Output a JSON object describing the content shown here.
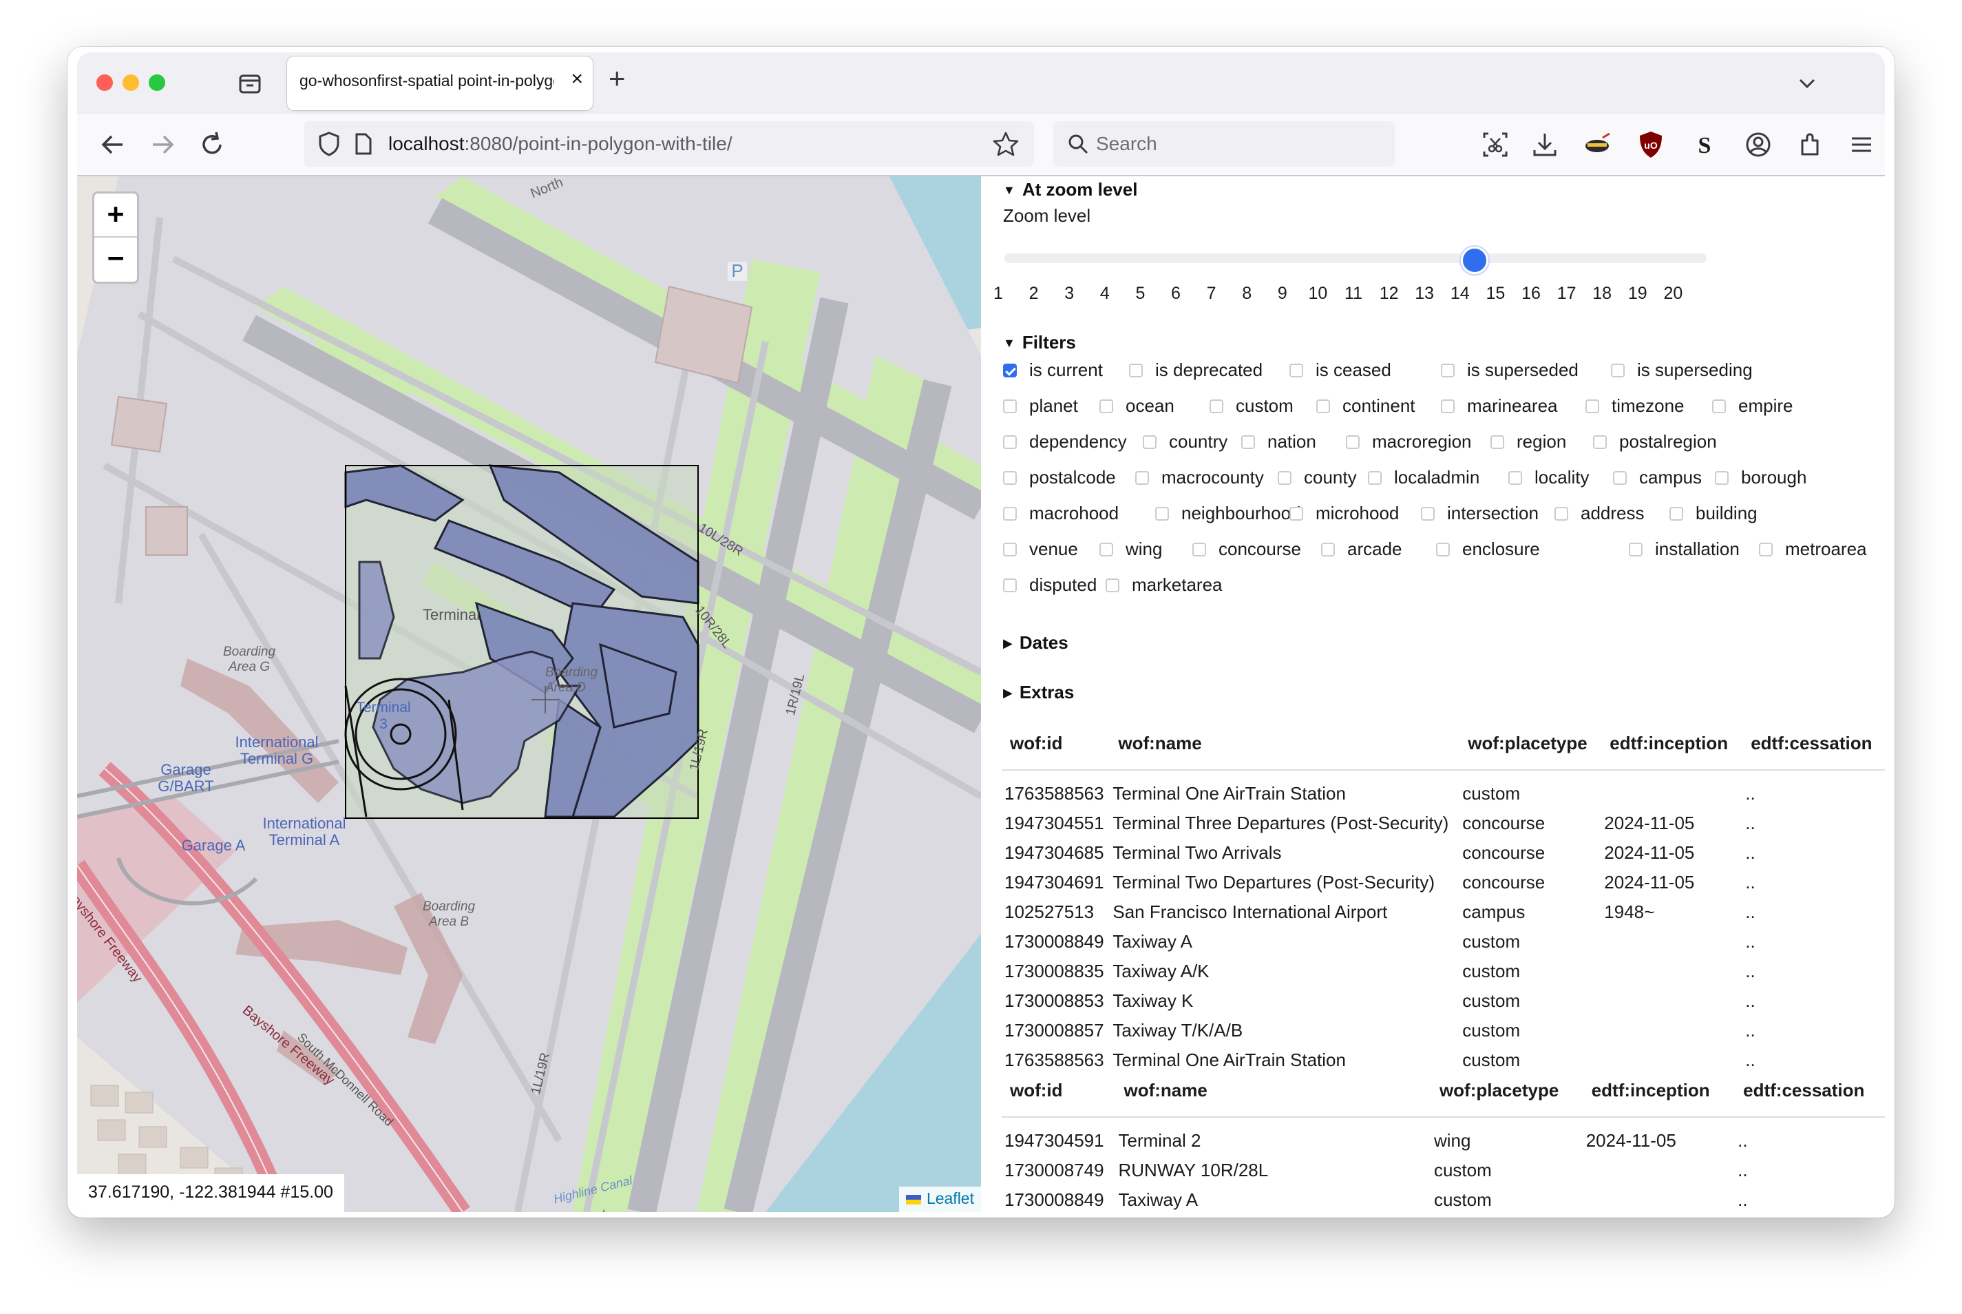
{
  "browser": {
    "tab_title": "go-whosonfirst-spatial point-in-polygon-with-tile",
    "url_host": "localhost",
    "url_rest": ":8080/point-in-polygon-with-tile/",
    "search_placeholder": "Search",
    "traffic_lights": {
      "close": "#fe5f57",
      "minimize": "#febc2e",
      "zoom": "#28c840"
    }
  },
  "map": {
    "zoom_in_label": "+",
    "zoom_out_label": "−",
    "coordinates": "37.617190, -122.381944 #15.00",
    "attribution": "Leaflet",
    "labels": {
      "terminal": "Terminal",
      "boarding_g": "Boarding Area G",
      "boarding_d": "Boarding Area D",
      "boarding_b": "Boarding Area B",
      "intl_terminal_g": "International Terminal G",
      "intl_terminal_a": "International Terminal A",
      "garage_g": "Garage G/BART",
      "garage_a": "Garage A",
      "terminal_3": "Terminal 3",
      "bayshore_1": "Bayshore Freeway",
      "bayshore_2": "Bayshore Freeway",
      "south_mcdonnell": "South McDonnell Road",
      "highline": "Highline Canal",
      "runway_10l": "10L/28R",
      "runway_10r": "10R/28L",
      "runway_1l": "1L/19R",
      "runway_1r": "1R/19L",
      "north": "North"
    }
  },
  "panel": {
    "zoom_section": "At zoom level",
    "zoom_label": "Zoom level",
    "zoom_value": 15,
    "zoom_ticks": [
      "1",
      "2",
      "3",
      "4",
      "5",
      "6",
      "7",
      "8",
      "9",
      "10",
      "11",
      "12",
      "13",
      "14",
      "15",
      "16",
      "17",
      "18",
      "19",
      "20"
    ],
    "filters_section": "Filters",
    "filter_rows": [
      [
        {
          "label": "is current",
          "checked": true
        },
        {
          "label": "is deprecated"
        },
        {
          "label": "is ceased"
        },
        {
          "label": "is superseded"
        },
        {
          "label": "is superseding"
        }
      ],
      [
        {
          "label": "planet"
        },
        {
          "label": "ocean"
        },
        {
          "label": "custom"
        },
        {
          "label": "continent"
        },
        {
          "label": "marinearea"
        },
        {
          "label": "timezone"
        },
        {
          "label": "empire"
        }
      ],
      [
        {
          "label": "dependency"
        },
        {
          "label": "country"
        },
        {
          "label": "nation"
        },
        {
          "label": "macroregion"
        },
        {
          "label": "region"
        },
        {
          "label": "postalregion"
        }
      ],
      [
        {
          "label": "postalcode"
        },
        {
          "label": "macrocounty"
        },
        {
          "label": "county"
        },
        {
          "label": "localadmin"
        },
        {
          "label": "locality"
        },
        {
          "label": "campus"
        },
        {
          "label": "borough"
        }
      ],
      [
        {
          "label": "macrohood"
        },
        {
          "label": "neighbourhood"
        },
        {
          "label": "microhood"
        },
        {
          "label": "intersection"
        },
        {
          "label": "address"
        },
        {
          "label": "building"
        }
      ],
      [
        {
          "label": "venue"
        },
        {
          "label": "wing"
        },
        {
          "label": "concourse"
        },
        {
          "label": "arcade"
        },
        {
          "label": "enclosure"
        },
        {
          "label": "installation"
        },
        {
          "label": "metroarea"
        }
      ],
      [
        {
          "label": "disputed"
        },
        {
          "label": "marketarea"
        }
      ]
    ],
    "dates_section": "Dates",
    "extras_section": "Extras",
    "table_headers": [
      "wof:id",
      "wof:name",
      "wof:placetype",
      "edtf:inception",
      "edtf:cessation"
    ],
    "results_1": [
      [
        "1763588563",
        "Terminal One AirTrain Station",
        "custom",
        "",
        ".."
      ],
      [
        "1947304551",
        "Terminal Three Departures (Post-Security)",
        "concourse",
        "2024-11-05",
        ".."
      ],
      [
        "1947304685",
        "Terminal Two Arrivals",
        "concourse",
        "2024-11-05",
        ".."
      ],
      [
        "1947304691",
        "Terminal Two Departures (Post-Security)",
        "concourse",
        "2024-11-05",
        ".."
      ],
      [
        "102527513",
        "San Francisco International Airport",
        "campus",
        "1948~",
        ".."
      ],
      [
        "1730008849",
        "Taxiway A",
        "custom",
        "",
        ".."
      ],
      [
        "1730008835",
        "Taxiway A/K",
        "custom",
        "",
        ".."
      ],
      [
        "1730008853",
        "Taxiway K",
        "custom",
        "",
        ".."
      ],
      [
        "1730008857",
        "Taxiway T/K/A/B",
        "custom",
        "",
        ".."
      ],
      [
        "1763588563",
        "Terminal One AirTrain Station",
        "custom",
        "",
        ".."
      ]
    ],
    "results_2": [
      [
        "1947304591",
        "Terminal 2",
        "wing",
        "2024-11-05",
        ".."
      ],
      [
        "1730008749",
        "RUNWAY 10R/28L",
        "custom",
        "",
        ".."
      ],
      [
        "1730008849",
        "Taxiway A",
        "custom",
        "",
        ".."
      ]
    ]
  }
}
